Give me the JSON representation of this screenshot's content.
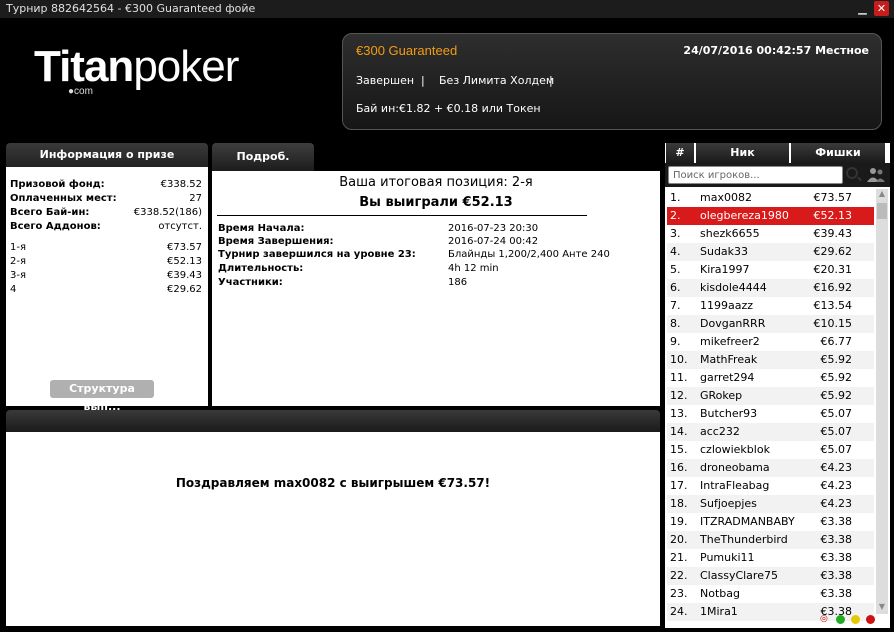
{
  "window": {
    "title": "Турнир 882642564 - €300 Guaranteed фойе"
  },
  "logo": {
    "titan": "Titan",
    "poker": "poker",
    "com": "●com"
  },
  "tournament": {
    "name": "€300 Guaranteed",
    "date": "24/07/2016 00:42:57  Местное",
    "status": "Завершен",
    "separator": "|",
    "game": "Без Лимита Холдем",
    "buyin": "Бай ин:€1.82 + €0.18 или Токен"
  },
  "prize": {
    "header": "Информация о призе",
    "summary": [
      {
        "label": "Призовой фонд:",
        "value": "€338.52"
      },
      {
        "label": "Оплаченных мест:",
        "value": "27"
      },
      {
        "label": "Всего Бай-ин:",
        "value": "€338.52(186)"
      },
      {
        "label": "Всего Аддонов:",
        "value": "отсутст."
      }
    ],
    "places": [
      {
        "label": "1-я",
        "value": "€73.57"
      },
      {
        "label": "2-я",
        "value": "€52.13"
      },
      {
        "label": "3-я",
        "value": "€39.43"
      },
      {
        "label": "4",
        "value": "€29.62"
      }
    ],
    "structure_button": "Структура вып..."
  },
  "details": {
    "tab": "Подроб.",
    "final_position": "Ваша итоговая позиция: 2-я",
    "you_won": "Вы выиграли €52.13",
    "rows": [
      {
        "label": "Время Начала:",
        "value": "2016-07-23 20:30"
      },
      {
        "label": "Время Завершения:",
        "value": "2016-07-24 00:42"
      },
      {
        "label": "Турнир завершился на уровне 23:",
        "value": "Блайнды 1,200/2,400 Анте 240"
      },
      {
        "label": "Длительность:",
        "value": "4h 12 min"
      },
      {
        "label": "Участники:",
        "value": "186"
      }
    ]
  },
  "congrats": "Поздравляем max0082 с выигрышем €73.57!",
  "players": {
    "headers": {
      "num": "#",
      "nick": "Ник",
      "chips": "Фишки"
    },
    "search_placeholder": "Поиск игроков...",
    "rows": [
      {
        "num": "1.",
        "nick": "max0082",
        "chips": "€73.57"
      },
      {
        "num": "2.",
        "nick": "olegbereza1980",
        "chips": "€52.13",
        "selected": true
      },
      {
        "num": "3.",
        "nick": "shezk6655",
        "chips": "€39.43"
      },
      {
        "num": "4.",
        "nick": "Sudak33",
        "chips": "€29.62"
      },
      {
        "num": "5.",
        "nick": "Kira1997",
        "chips": "€20.31"
      },
      {
        "num": "6.",
        "nick": "kisdole4444",
        "chips": "€16.92"
      },
      {
        "num": "7.",
        "nick": "1199aazz",
        "chips": "€13.54"
      },
      {
        "num": "8.",
        "nick": "DovganRRR",
        "chips": "€10.15"
      },
      {
        "num": "9.",
        "nick": "mikefreer2",
        "chips": "€6.77"
      },
      {
        "num": "10.",
        "nick": "MathFreak",
        "chips": "€5.92"
      },
      {
        "num": "11.",
        "nick": "garret294",
        "chips": "€5.92"
      },
      {
        "num": "12.",
        "nick": "GRokep",
        "chips": "€5.92"
      },
      {
        "num": "13.",
        "nick": "Butcher93",
        "chips": "€5.07"
      },
      {
        "num": "14.",
        "nick": "acc232",
        "chips": "€5.07"
      },
      {
        "num": "15.",
        "nick": "czlowiekblok",
        "chips": "€5.07"
      },
      {
        "num": "16.",
        "nick": "droneobama",
        "chips": "€4.23"
      },
      {
        "num": "17.",
        "nick": "IntraFleabag",
        "chips": "€4.23"
      },
      {
        "num": "18.",
        "nick": "Sufjoepjes",
        "chips": "€4.23"
      },
      {
        "num": "19.",
        "nick": "ITZRADMANBABY",
        "chips": "€3.38"
      },
      {
        "num": "20.",
        "nick": "TheThunderbird",
        "chips": "€3.38"
      },
      {
        "num": "21.",
        "nick": "Pumuki11",
        "chips": "€3.38"
      },
      {
        "num": "22.",
        "nick": "ClassyClare75",
        "chips": "€3.38"
      },
      {
        "num": "23.",
        "nick": "Notbag",
        "chips": "€3.38"
      },
      {
        "num": "24.",
        "nick": "1Mira1",
        "chips": "€3.38"
      }
    ]
  },
  "status_colors": {
    "green": "#22aa22",
    "yellow": "#e6c800",
    "red": "#cc1111",
    "selected_row": "#d81a1a",
    "accent": "#f39c12"
  }
}
